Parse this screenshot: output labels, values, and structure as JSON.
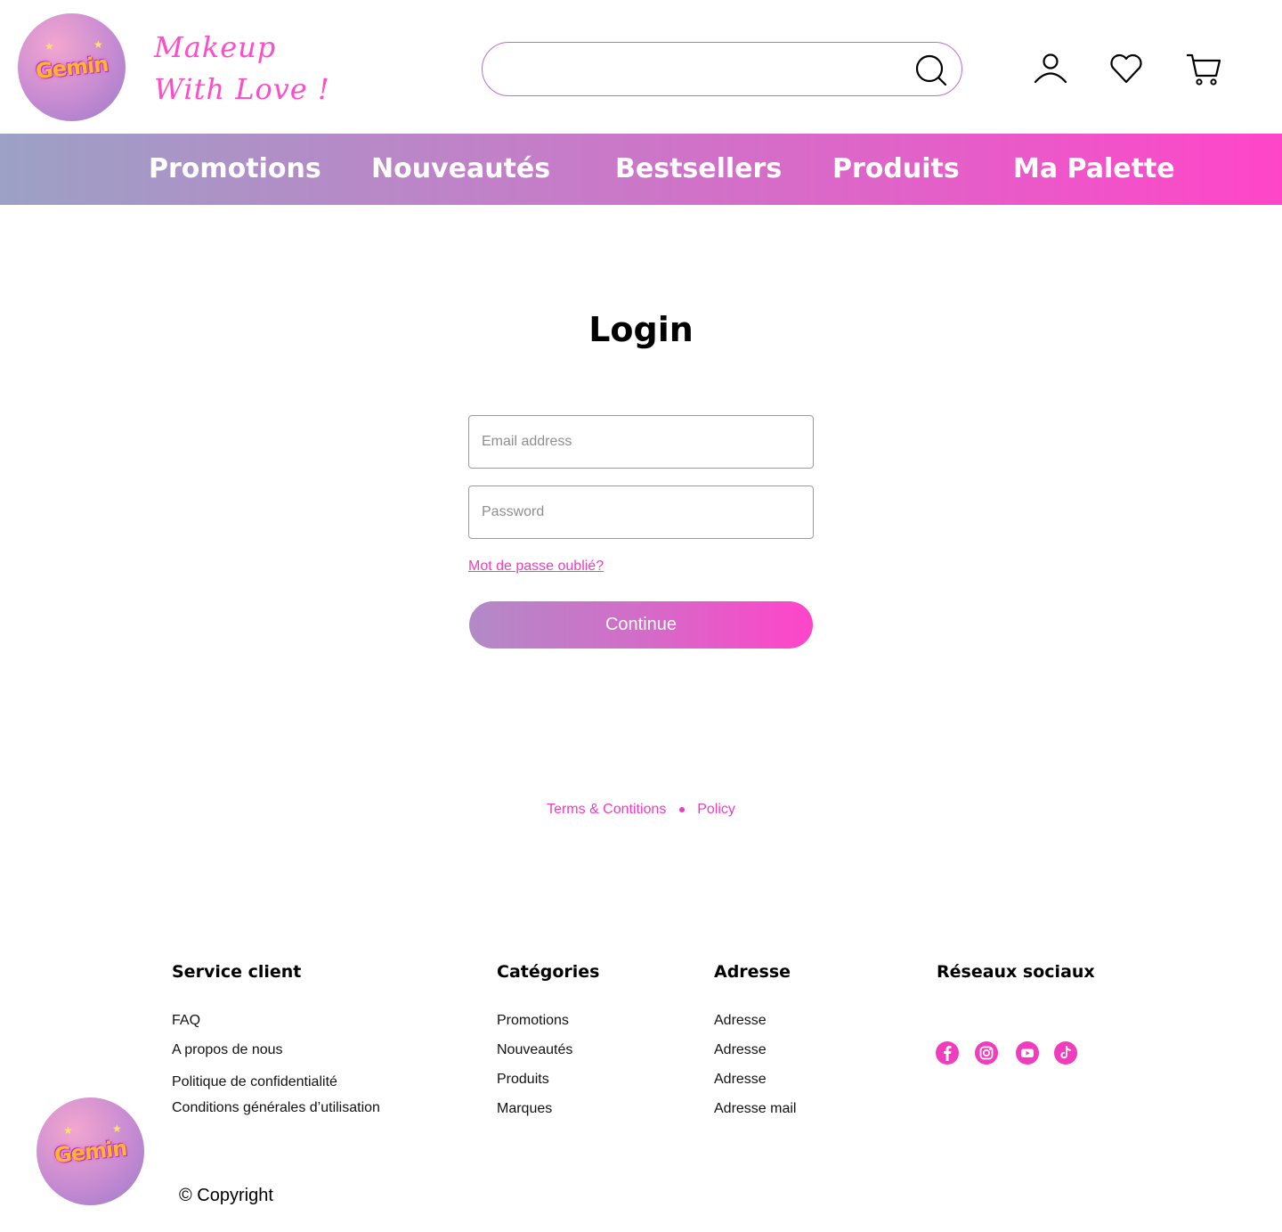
{
  "brand": {
    "logo_text": "Gemin",
    "tagline_line1": "Makeup",
    "tagline_line2": "With Love !"
  },
  "search": {
    "placeholder": ""
  },
  "header_icons": [
    "user-icon",
    "heart-icon",
    "cart-icon"
  ],
  "nav": {
    "items": [
      "Promotions",
      "Nouveautés",
      "Bestsellers",
      "Produits",
      "Ma Palette"
    ]
  },
  "login": {
    "title": "Login",
    "email_placeholder": "Email address",
    "password_placeholder": "Password",
    "forgot_label": "Mot de passe oublié?",
    "continue_label": "Continue"
  },
  "legal": {
    "terms": "Terms & Contitions",
    "policy": "Policy"
  },
  "footer": {
    "service": {
      "heading": "Service client",
      "links": [
        "FAQ",
        "A propos de nous",
        "Politique de confidentialité",
        "Conditions générales d’utilisation"
      ]
    },
    "categories": {
      "heading": "Catégories",
      "links": [
        "Promotions",
        "Nouveautés",
        "Produits",
        "Marques"
      ]
    },
    "address": {
      "heading": "Adresse",
      "links": [
        "Adresse",
        "Adresse",
        "Adresse",
        "Adresse mail"
      ]
    },
    "social": {
      "heading": "Réseaux sociaux",
      "icons": [
        "facebook-icon",
        "instagram-icon",
        "youtube-icon",
        "tiktok-icon"
      ]
    },
    "copyright": "© Copyright"
  },
  "colors": {
    "accent": "#f03cbd",
    "nav_gradient_start": "#9ca1c5",
    "nav_gradient_end": "#ff45c9",
    "search_border": "#b76fd8"
  }
}
